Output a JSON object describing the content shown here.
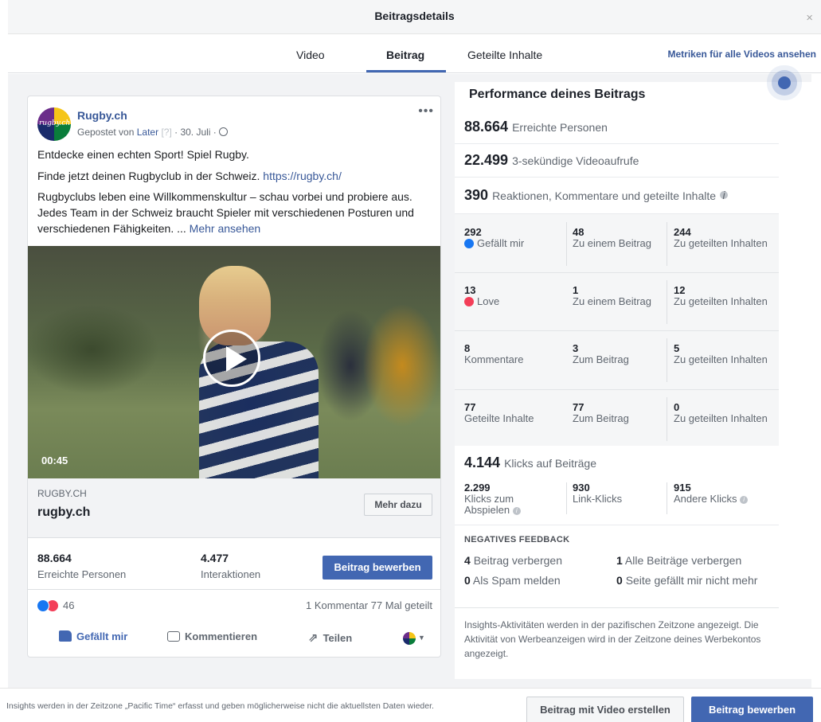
{
  "modal": {
    "title": "Beitragsdetails",
    "close": "×"
  },
  "tabs": [
    {
      "label": "Video"
    },
    {
      "label": "Beitrag"
    },
    {
      "label": "Geteilte Inhalte"
    }
  ],
  "metrics_link": "Metriken für alle Videos ansehen",
  "post": {
    "avatar_text": "rugby.ch",
    "page_name": "Rugby.ch",
    "meta_prefix": "Gepostet von",
    "meta_later": "Later",
    "meta_q": "[?]",
    "meta_date": "· 30. Juli ·",
    "text1": "Entdecke einen echten Sport! Spiel Rugby.",
    "text2": "Finde jetzt deinen Rugbyclub in der Schweiz.",
    "text2_link": "https://rugby.ch/",
    "text3": "Rugbyclubs leben eine Willkommenskultur – schau vorbei und probiere aus. Jedes Team in der Schweiz braucht Spieler mit verschiedenen Posturen und verschiedenen Fähigkeiten. ...",
    "text3_link": "Mehr ansehen",
    "video_time": "00:45",
    "link_domain": "RUGBY.CH",
    "link_title": "rugby.ch",
    "link_button": "Mehr dazu",
    "reach_value": "88.664",
    "reach_label": "Erreichte Personen",
    "interactions_value": "4.477",
    "interactions_label": "Interaktionen",
    "promote_button": "Beitrag bewerben",
    "reaction_count": "46",
    "comments_shares": "1 Kommentar  77 Mal geteilt",
    "action_like": "Gefällt mir",
    "action_comment": "Kommentieren",
    "action_share": "Teilen"
  },
  "performance": {
    "title": "Performance deines Beitrags",
    "reach_value": "88.664",
    "reach_label": "Erreichte Personen",
    "views_value": "22.499",
    "views_label": "3-sekündige Videoaufrufe",
    "reactions_value": "390",
    "reactions_label": "Reaktionen, Kommentare und geteilte Inhalte",
    "grid": [
      {
        "v1": "292",
        "l1": "Gefällt mir",
        "v2": "48",
        "l2": "Zu einem Beitrag",
        "v3": "244",
        "l3": "Zu geteilten Inhalten"
      },
      {
        "v1": "13",
        "l1": "Love",
        "v2": "1",
        "l2": "Zu einem Beitrag",
        "v3": "12",
        "l3": "Zu geteilten Inhalten"
      },
      {
        "v1": "8",
        "l1": "Kommentare",
        "v2": "3",
        "l2": "Zum Beitrag",
        "v3": "5",
        "l3": "Zu geteilten Inhalten"
      },
      {
        "v1": "77",
        "l1": "Geteilte Inhalte",
        "v2": "77",
        "l2": "Zum Beitrag",
        "v3": "0",
        "l3": "Zu geteilten Inhalten"
      }
    ],
    "clicks_value": "4.144",
    "clicks_label": "Klicks auf Beiträge",
    "clicks_grid": [
      {
        "value": "2.299",
        "label": "Klicks zum Abspielen"
      },
      {
        "value": "930",
        "label": "Link-Klicks"
      },
      {
        "value": "915",
        "label": "Andere Klicks"
      }
    ],
    "negative_title": "NEGATIVES FEEDBACK",
    "neg_hide_value": "4",
    "neg_hide_label": "Beitrag verbergen",
    "neg_hide_all_value": "1",
    "neg_hide_all_label": "Alle Beiträge verbergen",
    "neg_spam_value": "0",
    "neg_spam_label": "Als Spam melden",
    "neg_unlike_value": "0",
    "neg_unlike_label": "Seite gefällt mir nicht mehr",
    "note": "Insights-Aktivitäten werden in der pazifischen Zeitzone angezeigt. Die Aktivität von Werbeanzeigen wird in der Zeitzone deines Werbekontos angezeigt."
  },
  "footer": {
    "note": "Insights werden in der Zeitzone „Pacific Time“ erfasst und geben möglicherweise nicht die aktuellsten Daten wieder.",
    "create_button": "Beitrag mit Video erstellen",
    "promote_button": "Beitrag bewerben"
  }
}
